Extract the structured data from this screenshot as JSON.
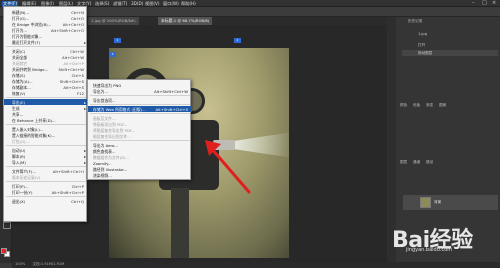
{
  "menubar": {
    "items": [
      "文件(F)",
      "编辑(E)",
      "图像(I)",
      "图层(L)",
      "文字(Y)",
      "选择(S)",
      "滤镜(T)",
      "3D(D)",
      "视图(V)",
      "窗口(W)",
      "帮助(H)"
    ]
  },
  "document_tabs": [
    "1.jpg @ 100%(RGB/8#)",
    "未标题-1 @ 66.7%(RGB/8)"
  ],
  "file_menu": {
    "items": [
      {
        "label": "新建(N)...",
        "shortcut": "Ctrl+N"
      },
      {
        "label": "打开(O)...",
        "shortcut": "Ctrl+O"
      },
      {
        "label": "在 Bridge 中浏览(B)...",
        "shortcut": "Alt+Ctrl+O"
      },
      {
        "label": "打开为...",
        "shortcut": "Alt+Shift+Ctrl+O"
      },
      {
        "label": "打开为智能对象...",
        "shortcut": ""
      },
      {
        "label": "最近打开文件(T)",
        "shortcut": "",
        "submenu": true
      },
      {
        "label": "关闭(C)",
        "shortcut": "Ctrl+W"
      },
      {
        "label": "关闭全部",
        "shortcut": "Alt+Ctrl+W"
      },
      {
        "label": "关闭其它",
        "shortcut": "Alt+Ctrl+P"
      },
      {
        "label": "关闭并转到 Bridge...",
        "shortcut": "Shift+Ctrl+W"
      },
      {
        "label": "存储(S)",
        "shortcut": "Ctrl+S"
      },
      {
        "label": "存储为(A)...",
        "shortcut": "Shift+Ctrl+S"
      },
      {
        "label": "存储副本...",
        "shortcut": "Alt+Ctrl+S"
      },
      {
        "label": "恢复(V)",
        "shortcut": "F12"
      },
      {
        "label": "导出(E)",
        "shortcut": "",
        "submenu": true
      },
      {
        "label": "生成",
        "shortcut": "",
        "submenu": true
      },
      {
        "label": "共享...",
        "shortcut": ""
      },
      {
        "label": "在 Behance 上共享(D)...",
        "shortcut": ""
      },
      {
        "label": "置入嵌入对象(L)...",
        "shortcut": ""
      },
      {
        "label": "置入链接的智能对象(K)...",
        "shortcut": ""
      },
      {
        "label": "打包(G)...",
        "shortcut": ""
      },
      {
        "label": "自动(U)",
        "shortcut": "",
        "submenu": true
      },
      {
        "label": "脚本(R)",
        "shortcut": "",
        "submenu": true
      },
      {
        "label": "导入(M)",
        "shortcut": "",
        "submenu": true
      },
      {
        "label": "文件简介(F)...",
        "shortcut": "Alt+Shift+Ctrl+I"
      },
      {
        "label": "版本历史记录(V)",
        "shortcut": ""
      },
      {
        "label": "打印(P)...",
        "shortcut": "Ctrl+P"
      },
      {
        "label": "打印一份(Y)",
        "shortcut": "Alt+Shift+Ctrl+P"
      },
      {
        "label": "退出(X)",
        "shortcut": "Ctrl+Q"
      }
    ]
  },
  "export_menu": {
    "items": [
      {
        "label": "快速导出为 PNG",
        "shortcut": ""
      },
      {
        "label": "导出为...",
        "shortcut": "Alt+Shift+Ctrl+W"
      },
      {
        "label": "导出首选项...",
        "shortcut": ""
      },
      {
        "label": "存储为 Web 所用格式 (旧版)...",
        "shortcut": "Alt+Shift+Ctrl+S"
      },
      {
        "label": "画板至文件...",
        "shortcut": ""
      },
      {
        "label": "将画板导出到 PDF...",
        "shortcut": ""
      },
      {
        "label": "将图层复合导出到 PDF...",
        "shortcut": ""
      },
      {
        "label": "图层复合导出到文件...",
        "shortcut": ""
      },
      {
        "label": "导出为 Aero...",
        "shortcut": ""
      },
      {
        "label": "颜色查找表...",
        "shortcut": ""
      },
      {
        "label": "数据组作为文件(D)...",
        "shortcut": ""
      },
      {
        "label": "Zoomify...",
        "shortcut": ""
      },
      {
        "label": "路径到 Illustrator...",
        "shortcut": ""
      },
      {
        "label": "渲染视频...",
        "shortcut": ""
      }
    ]
  },
  "right_panel": {
    "history_title": "历史记录",
    "history_file": "1.jpg",
    "history_items": [
      "打开",
      "拖动图层"
    ],
    "adjust_tabs": [
      "颜色",
      "色板",
      "渐变",
      "图案"
    ],
    "layers_tabs": [
      "图层",
      "通道",
      "路径"
    ],
    "layer_name": "背景"
  },
  "status": {
    "zoom": "100%",
    "doc": "文档:1.91M/1.91M"
  },
  "markers": [
    "1",
    "2",
    "3"
  ],
  "watermark": {
    "text": "Bai经验",
    "sub": "jingyan.baidu.com"
  },
  "colors": {
    "accent": "#1e5aa8",
    "foreground": "#e6252b",
    "background": "#ffffff",
    "arrow": "#e0201f"
  }
}
